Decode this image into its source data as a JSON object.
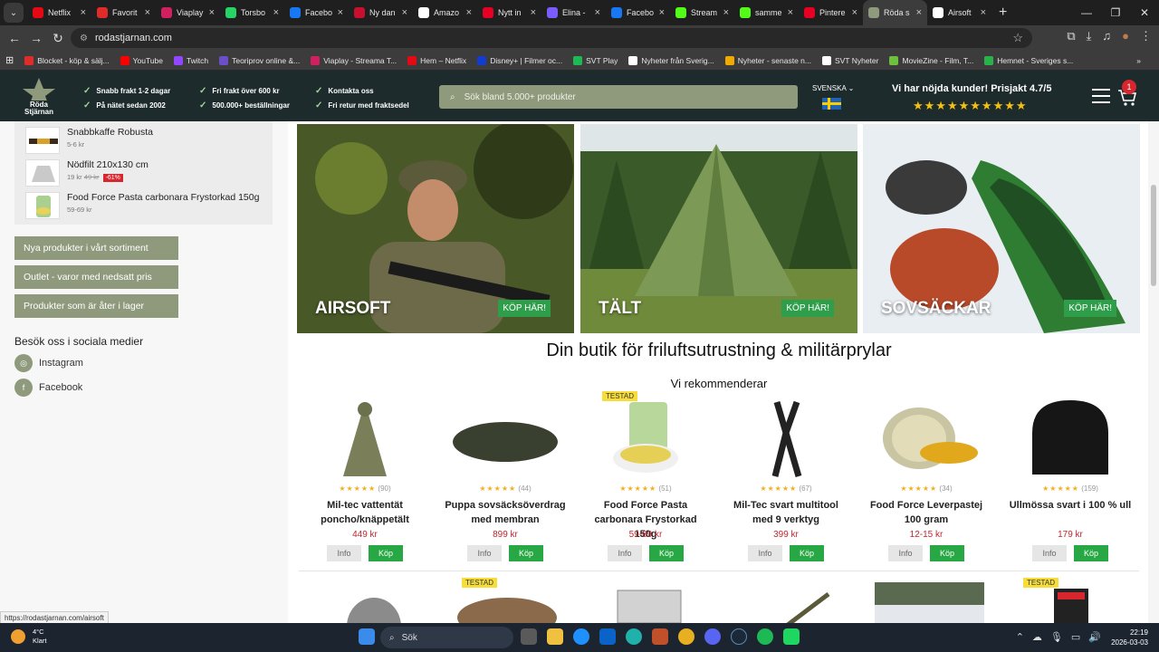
{
  "browser": {
    "tabs": [
      {
        "title": "Netflix",
        "color": "#e50914",
        "letter": "N"
      },
      {
        "title": "Favorit",
        "color": "#e12b2b",
        "letter": "b"
      },
      {
        "title": "Viaplay",
        "color": "#d1205f",
        "letter": "V"
      },
      {
        "title": "Torsbo",
        "color": "#25d366",
        "letter": "W"
      },
      {
        "title": "Facebo",
        "color": "#1877f2",
        "letter": "f"
      },
      {
        "title": "Ny dan",
        "color": "#c8102e",
        "letter": "P"
      },
      {
        "title": "Amazo",
        "color": "#ffffff",
        "letter": "a"
      },
      {
        "title": "Nytt in",
        "color": "#e60023",
        "letter": "P"
      },
      {
        "title": "Elina -",
        "color": "#7b5cff",
        "letter": "E"
      },
      {
        "title": "Facebo",
        "color": "#1877f2",
        "letter": "f"
      },
      {
        "title": "Stream",
        "color": "#53fc18",
        "letter": "K"
      },
      {
        "title": "samme",
        "color": "#53fc18",
        "letter": "K"
      },
      {
        "title": "Pintere",
        "color": "#e60023",
        "letter": "P"
      },
      {
        "title": "Röda s",
        "color": "#8f9a7c",
        "letter": "★",
        "active": true
      },
      {
        "title": "Airsoft",
        "color": "#ffffff",
        "letter": "◎"
      }
    ],
    "url": "rodastjarnan.com",
    "bookmarks": [
      {
        "label": "Blocket - köp & sälj...",
        "color": "#e12b2b"
      },
      {
        "label": "YouTube",
        "color": "#ff0000"
      },
      {
        "label": "Twitch",
        "color": "#9146ff"
      },
      {
        "label": "Teoriprov online &...",
        "color": "#6a4fc8"
      },
      {
        "label": "Viaplay - Streama T...",
        "color": "#d1205f"
      },
      {
        "label": "Hem – Netflix",
        "color": "#e50914"
      },
      {
        "label": "Disney+ | Filmer oc...",
        "color": "#113ccf"
      },
      {
        "label": "SVT Play",
        "color": "#1db954"
      },
      {
        "label": "Nyheter från Sverig...",
        "color": "#ffffff"
      },
      {
        "label": "Nyheter - senaste n...",
        "color": "#f2a900"
      },
      {
        "label": "SVT Nyheter",
        "color": "#ffffff"
      },
      {
        "label": "MovieZine - Film, T...",
        "color": "#6fbf3f"
      },
      {
        "label": "Hemnet - Sveriges s...",
        "color": "#2ab24a"
      }
    ]
  },
  "header": {
    "logo_text": "Röda Stjärnan",
    "usps": [
      "Snabb frakt 1-2 dagar",
      "På nätet sedan 2002",
      "Fri frakt över 600 kr",
      "500.000+ beställningar",
      "Kontakta oss",
      "Fri retur med fraktsedel"
    ],
    "search_placeholder": "Sök bland 5.000+ produkter",
    "language": "SVENSKA",
    "rating_text": "Vi har nöjda kunder! Prisjakt 4.7/5",
    "stars": "★★★★★★★★★★",
    "cart_count": "1"
  },
  "sidebar": {
    "recent": [
      {
        "name": "Snabbkaffe Robusta",
        "price": "5-6 kr"
      },
      {
        "name": "Nödfilt 210x130 cm",
        "price": "19 kr",
        "old_price": "49 kr",
        "discount": "-61%"
      },
      {
        "name": "Food Force Pasta carbonara Frystorkad 150g",
        "price": "59-69 kr"
      }
    ],
    "buttons": [
      "Nya produkter i vårt sortiment",
      "Outlet - varor med nedsatt pris",
      "Produkter som är åter i lager"
    ],
    "social_heading": "Besök oss i sociala medier",
    "social": [
      "Instagram",
      "Facebook"
    ]
  },
  "banners": [
    {
      "label": "AIRSOFT",
      "button": "KÖP HÄR!"
    },
    {
      "label": "TÄLT",
      "button": "KÖP HÄR!"
    },
    {
      "label": "SOVSÄCKAR",
      "button": "KÖP HÄR!"
    }
  ],
  "main": {
    "heading": "Din butik för friluftsutrustning & militärprylar",
    "subheading": "Vi rekommenderar",
    "tested_label": "TESTAD",
    "info_label": "Info",
    "buy_label": "Köp",
    "products": [
      {
        "name": "Mil-tec vattentät poncho/knäppetält",
        "price": "449 kr",
        "reviews": "(90)",
        "stars": "★★★★★"
      },
      {
        "name": "Puppa sovsäcksöverdrag med membran",
        "price": "899 kr",
        "reviews": "(44)",
        "stars": "★★★★★"
      },
      {
        "name": "Food Force Pasta carbonara Frystorkad 150g",
        "price": "59-69 kr",
        "reviews": "(51)",
        "stars": "★★★★★",
        "tested": true
      },
      {
        "name": "Mil-Tec svart multitool med 9 verktyg",
        "price": "399 kr",
        "reviews": "(67)",
        "stars": "★★★★★"
      },
      {
        "name": "Food Force Leverpastej 100 gram",
        "price": "12-15 kr",
        "reviews": "(34)",
        "stars": "★★★★★"
      },
      {
        "name": "Ullmössa svart i 100 % ull",
        "price": "179 kr",
        "reviews": "(159)",
        "stars": "★★★★★"
      }
    ]
  },
  "status_url": "https://rodastjarnan.com/airsoft",
  "taskbar": {
    "weather_temp": "4°C",
    "weather_desc": "Klart",
    "search": "Sök",
    "time": "22:19",
    "date": "2026-03-03"
  }
}
